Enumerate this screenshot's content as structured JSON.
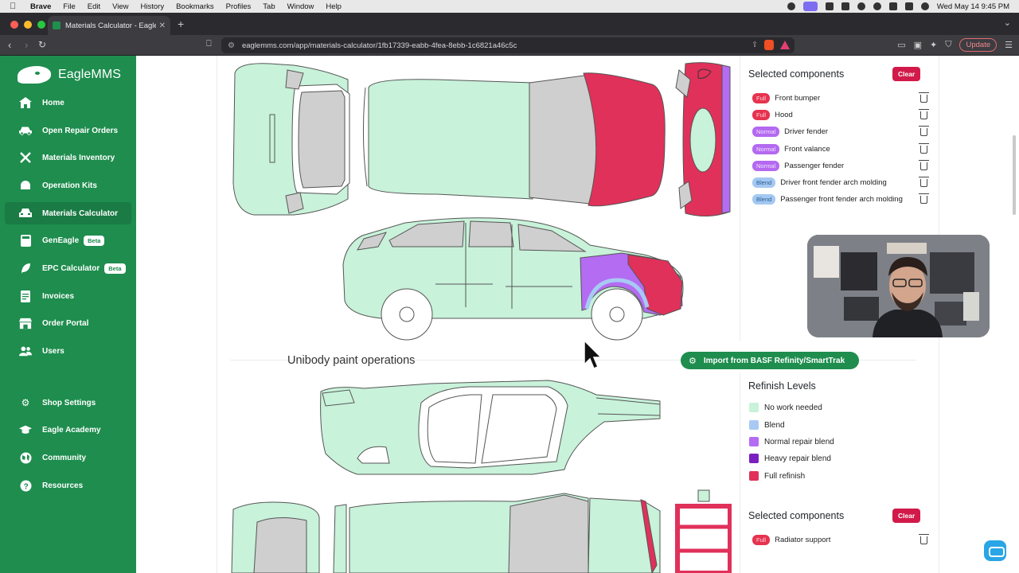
{
  "menubar": {
    "app": "Brave",
    "items": [
      "File",
      "Edit",
      "View",
      "History",
      "Bookmarks",
      "Profiles",
      "Tab",
      "Window",
      "Help"
    ],
    "clock": "Wed May 14  9:45 PM"
  },
  "browser": {
    "tab_title": "Materials Calculator - EagleM",
    "url": "eaglemms.com/app/materials-calculator/1fb17339-eabb-4fea-8ebb-1c6821a46c5c",
    "update_label": "Update"
  },
  "sidebar": {
    "brand": "EagleMMS",
    "items": [
      {
        "label": "Home",
        "icon": "home-icon"
      },
      {
        "label": "Open Repair Orders",
        "icon": "car-icon"
      },
      {
        "label": "Materials Inventory",
        "icon": "tools-icon"
      },
      {
        "label": "Operation Kits",
        "icon": "kit-icon"
      },
      {
        "label": "Materials Calculator",
        "icon": "car-front-icon",
        "active": true
      },
      {
        "label": "GenEagle",
        "icon": "calculator-icon",
        "badge": "Beta"
      },
      {
        "label": "EPC Calculator",
        "icon": "leaf-icon",
        "badge": "Beta"
      },
      {
        "label": "Invoices",
        "icon": "invoice-icon"
      },
      {
        "label": "Order Portal",
        "icon": "store-icon"
      },
      {
        "label": "Users",
        "icon": "users-icon"
      },
      {
        "label": "Shop Settings",
        "icon": "gear-icon"
      },
      {
        "label": "Eagle Academy",
        "icon": "graduation-icon"
      },
      {
        "label": "Community",
        "icon": "globe-icon"
      },
      {
        "label": "Resources",
        "icon": "help-icon"
      }
    ]
  },
  "top_panel": {
    "title": "Selected components",
    "clear_label": "Clear",
    "components": [
      {
        "level": "Full",
        "name": "Front bumper"
      },
      {
        "level": "Full",
        "name": "Hood"
      },
      {
        "level": "Normal",
        "name": "Driver fender"
      },
      {
        "level": "Normal",
        "name": "Front valance"
      },
      {
        "level": "Normal",
        "name": "Passenger fender"
      },
      {
        "level": "Blend",
        "name": "Driver front fender arch molding"
      },
      {
        "level": "Blend",
        "name": "Passenger front fender arch molding"
      }
    ]
  },
  "unibody": {
    "title": "Unibody paint operations",
    "import_label": "Import from BASF Refinity/SmartTrak"
  },
  "refinish_levels": {
    "title": "Refinish Levels",
    "items": [
      {
        "label": "No work needed",
        "color": "#c8f2da"
      },
      {
        "label": "Blend",
        "color": "#a8c9f3"
      },
      {
        "label": "Normal repair blend",
        "color": "#b46cf2"
      },
      {
        "label": "Heavy repair blend",
        "color": "#7a1fc0"
      },
      {
        "label": "Full refinish",
        "color": "#e0315a"
      }
    ]
  },
  "bottom_panel": {
    "title": "Selected components",
    "clear_label": "Clear",
    "components": [
      {
        "level": "Full",
        "name": "Radiator support"
      }
    ]
  },
  "colors": {
    "brand_green": "#1e8d4e",
    "panel_green": "#c8f2da",
    "gray_glass": "#cfcfcf",
    "full_red": "#e0315a",
    "normal_purple": "#b46cf2",
    "blend_blue": "#a8c9f3"
  }
}
